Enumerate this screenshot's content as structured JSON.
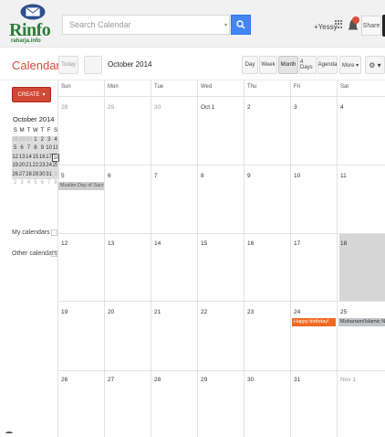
{
  "brand": {
    "name": "Rinfo",
    "subtitle": "raharja.info"
  },
  "search": {
    "placeholder": "Search Calendar"
  },
  "header": {
    "user": "+Yessy",
    "share_label": "Share"
  },
  "app": {
    "title": "Calendar"
  },
  "toolbar": {
    "today": "Today",
    "current_date": "October 2014",
    "views": [
      "Day",
      "Week",
      "Month",
      "4 Days",
      "Agenda"
    ],
    "active_view": "Month",
    "more": "More ▾",
    "settings": "⚙ ▾"
  },
  "sidebar": {
    "create_label": "CREATE",
    "mini_title": "October 2014",
    "mini_headers": [
      "S",
      "M",
      "T",
      "W",
      "T",
      "F",
      "S"
    ],
    "mini_weeks": [
      [
        "28",
        "29",
        "30",
        "1",
        "2",
        "3",
        "4"
      ],
      [
        "5",
        "6",
        "7",
        "8",
        "9",
        "10",
        "11"
      ],
      [
        "12",
        "13",
        "14",
        "15",
        "16",
        "17",
        "18"
      ],
      [
        "19",
        "20",
        "21",
        "22",
        "23",
        "24",
        "25"
      ],
      [
        "26",
        "27",
        "28",
        "29",
        "30",
        "31",
        "1"
      ],
      [
        "2",
        "3",
        "4",
        "5",
        "6",
        "7",
        "8"
      ]
    ],
    "my_calendars": "My calendars",
    "other_calendars": "Other calendars"
  },
  "calendar": {
    "days_of_week": [
      "Sun",
      "Mon",
      "Tue",
      "Wed",
      "Thu",
      "Fri",
      "Sat"
    ],
    "weeks": [
      [
        "28",
        "29",
        "30",
        "Oct 1",
        "2",
        "3",
        "4"
      ],
      [
        "5",
        "6",
        "7",
        "8",
        "9",
        "10",
        "11"
      ],
      [
        "12",
        "13",
        "14",
        "15",
        "16",
        "17",
        "18"
      ],
      [
        "19",
        "20",
        "21",
        "22",
        "23",
        "24",
        "25"
      ],
      [
        "26",
        "27",
        "28",
        "29",
        "30",
        "31",
        "Nov 1"
      ]
    ],
    "events": [
      {
        "title": "Muslim Day of Sacrifice (Id",
        "color": "#cccccc"
      },
      {
        "title": "Happy birthday!",
        "color": "#f26a21"
      },
      {
        "title": "Muharram/Islamic New Ye",
        "color": "#bfc4c8"
      }
    ]
  },
  "colors": {
    "accent": "#dd4b39",
    "create": "#d14836",
    "search_button": "#4285f4"
  }
}
